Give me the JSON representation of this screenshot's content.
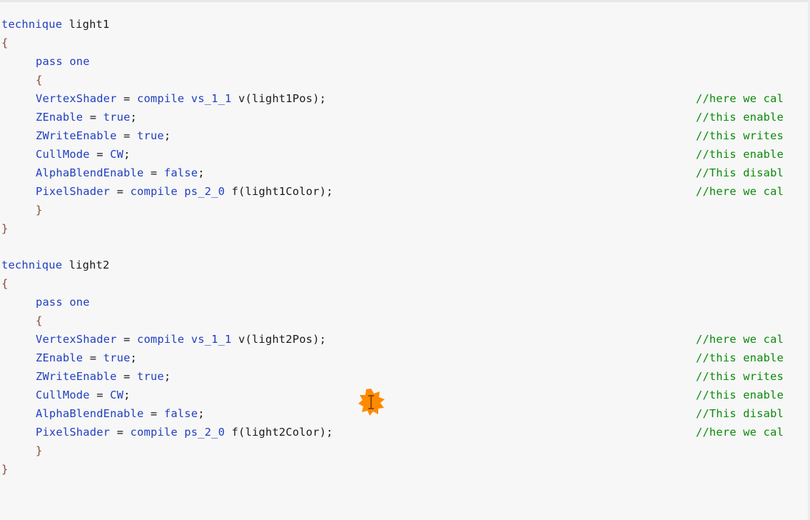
{
  "theme": {
    "background": "#f7f7f7",
    "keyword_color": "#1f3fc0",
    "text_color": "#1a1a1a",
    "comment_color": "#0a8a0a",
    "cursor_color": "#ff8a00"
  },
  "editor": {
    "lines": [
      {
        "id": "l1",
        "tokens": [
          {
            "t": "technique",
            "c": "kw"
          },
          {
            "t": " light1",
            "c": "txt"
          }
        ],
        "comment": ""
      },
      {
        "id": "l2",
        "tokens": [
          {
            "t": "{",
            "c": "brace"
          }
        ],
        "comment": ""
      },
      {
        "id": "l3",
        "tokens": [
          {
            "t": "pass one",
            "c": "kw"
          }
        ],
        "comment": ""
      },
      {
        "id": "l4",
        "tokens": [
          {
            "t": "{",
            "c": "brace"
          }
        ],
        "comment": ""
      },
      {
        "id": "l5",
        "tokens": [
          {
            "t": "VertexShader",
            "c": "kw"
          },
          {
            "t": " = ",
            "c": "txt"
          },
          {
            "t": "compile vs_1_1",
            "c": "kw"
          },
          {
            "t": " v(light1Pos);",
            "c": "txt"
          }
        ],
        "comment": "//here we cal"
      },
      {
        "id": "l6",
        "tokens": [
          {
            "t": "ZEnable",
            "c": "kw"
          },
          {
            "t": " = ",
            "c": "txt"
          },
          {
            "t": "true",
            "c": "kw"
          },
          {
            "t": ";",
            "c": "txt"
          }
        ],
        "comment": "//this enable"
      },
      {
        "id": "l7",
        "tokens": [
          {
            "t": "ZWriteEnable",
            "c": "kw"
          },
          {
            "t": " = ",
            "c": "txt"
          },
          {
            "t": "true",
            "c": "kw"
          },
          {
            "t": ";",
            "c": "txt"
          }
        ],
        "comment": "//this writes"
      },
      {
        "id": "l8",
        "tokens": [
          {
            "t": "CullMode",
            "c": "kw"
          },
          {
            "t": " = ",
            "c": "txt"
          },
          {
            "t": "CW",
            "c": "kw"
          },
          {
            "t": ";",
            "c": "txt"
          }
        ],
        "comment": "//this enable"
      },
      {
        "id": "l9",
        "tokens": [
          {
            "t": "AlphaBlendEnable",
            "c": "kw"
          },
          {
            "t": " = ",
            "c": "txt"
          },
          {
            "t": "false",
            "c": "kw"
          },
          {
            "t": ";",
            "c": "txt"
          }
        ],
        "comment": "//This disabl"
      },
      {
        "id": "l10",
        "tokens": [
          {
            "t": "PixelShader",
            "c": "kw"
          },
          {
            "t": " = ",
            "c": "txt"
          },
          {
            "t": "compile ps_2_0",
            "c": "kw"
          },
          {
            "t": " f(light1Color);",
            "c": "txt"
          }
        ],
        "comment": "//here we cal"
      },
      {
        "id": "l11",
        "tokens": [
          {
            "t": "}",
            "c": "brace"
          }
        ],
        "comment": ""
      },
      {
        "id": "l12",
        "tokens": [
          {
            "t": "}",
            "c": "brace"
          }
        ],
        "comment": ""
      },
      {
        "id": "l13",
        "tokens": [
          {
            "t": "technique",
            "c": "kw"
          },
          {
            "t": " light2",
            "c": "txt"
          }
        ],
        "comment": ""
      },
      {
        "id": "l14",
        "tokens": [
          {
            "t": "{",
            "c": "brace"
          }
        ],
        "comment": ""
      },
      {
        "id": "l15",
        "tokens": [
          {
            "t": "pass one",
            "c": "kw"
          }
        ],
        "comment": ""
      },
      {
        "id": "l16",
        "tokens": [
          {
            "t": "{",
            "c": "brace"
          }
        ],
        "comment": ""
      },
      {
        "id": "l17",
        "tokens": [
          {
            "t": "VertexShader",
            "c": "kw"
          },
          {
            "t": " = ",
            "c": "txt"
          },
          {
            "t": "compile vs_1_1",
            "c": "kw"
          },
          {
            "t": " v(light2Pos);",
            "c": "txt"
          }
        ],
        "comment": "//here we cal"
      },
      {
        "id": "l18",
        "tokens": [
          {
            "t": "ZEnable",
            "c": "kw"
          },
          {
            "t": " = ",
            "c": "txt"
          },
          {
            "t": "true",
            "c": "kw"
          },
          {
            "t": ";",
            "c": "txt"
          }
        ],
        "comment": "//this enable"
      },
      {
        "id": "l19",
        "tokens": [
          {
            "t": "ZWriteEnable",
            "c": "kw"
          },
          {
            "t": " = ",
            "c": "txt"
          },
          {
            "t": "true",
            "c": "kw"
          },
          {
            "t": ";",
            "c": "txt"
          }
        ],
        "comment": "//this writes"
      },
      {
        "id": "l20",
        "tokens": [
          {
            "t": "CullMode",
            "c": "kw"
          },
          {
            "t": " = ",
            "c": "txt"
          },
          {
            "t": "CW",
            "c": "kw"
          },
          {
            "t": ";",
            "c": "txt"
          }
        ],
        "comment": "//this enable"
      },
      {
        "id": "l21",
        "tokens": [
          {
            "t": "AlphaBlendEnable",
            "c": "kw"
          },
          {
            "t": " = ",
            "c": "txt"
          },
          {
            "t": "false",
            "c": "kw"
          },
          {
            "t": ";",
            "c": "txt"
          }
        ],
        "comment": "//This disabl"
      },
      {
        "id": "l22",
        "tokens": [
          {
            "t": "PixelShader",
            "c": "kw"
          },
          {
            "t": " = ",
            "c": "txt"
          },
          {
            "t": "compile ps_2_0",
            "c": "kw"
          },
          {
            "t": " f(light2Color);",
            "c": "txt"
          }
        ],
        "comment": "//here we cal"
      },
      {
        "id": "l23",
        "tokens": [
          {
            "t": "}",
            "c": "brace"
          }
        ],
        "comment": ""
      },
      {
        "id": "l24",
        "tokens": [
          {
            "t": "}",
            "c": "brace"
          }
        ],
        "comment": ""
      }
    ]
  },
  "cursor": {
    "icon": "text-cursor-highlight-icon"
  }
}
